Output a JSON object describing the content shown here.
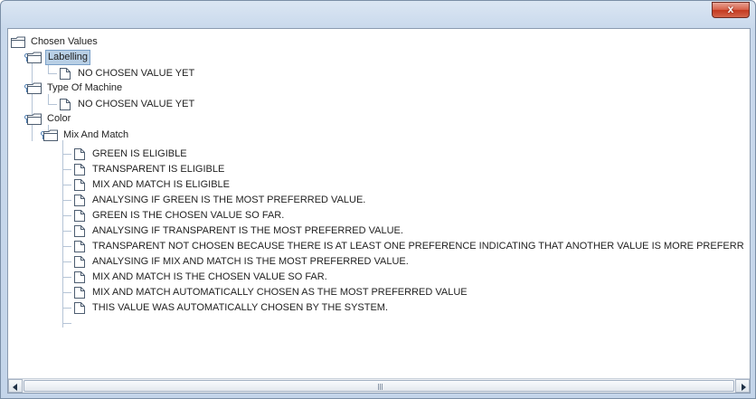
{
  "window": {
    "close_glyph": "x"
  },
  "tree": {
    "nodes": [
      {
        "label": "Chosen Values",
        "type": "folder"
      },
      {
        "label": "Labelling",
        "type": "folder",
        "selected": true
      },
      {
        "label": "NO CHOSEN VALUE YET",
        "type": "file"
      },
      {
        "label": "Type Of Machine",
        "type": "folder"
      },
      {
        "label": "NO CHOSEN VALUE YET",
        "type": "file"
      },
      {
        "label": "Color",
        "type": "folder"
      },
      {
        "label": "Mix And Match",
        "type": "folder"
      },
      {
        "label": "GREEN IS ELIGIBLE",
        "type": "file"
      },
      {
        "label": "TRANSPARENT IS ELIGIBLE",
        "type": "file"
      },
      {
        "label": "MIX AND MATCH IS ELIGIBLE",
        "type": "file"
      },
      {
        "label": "ANALYSING IF GREEN IS THE MOST PREFERRED VALUE.",
        "type": "file"
      },
      {
        "label": "GREEN IS THE CHOSEN VALUE SO FAR.",
        "type": "file"
      },
      {
        "label": "ANALYSING IF TRANSPARENT IS THE MOST PREFERRED VALUE.",
        "type": "file"
      },
      {
        "label": "TRANSPARENT NOT CHOSEN BECAUSE THERE IS AT LEAST ONE PREFERENCE INDICATING THAT ANOTHER VALUE IS MORE PREFERR",
        "type": "file"
      },
      {
        "label": "ANALYSING IF MIX AND MATCH IS THE MOST PREFERRED VALUE.",
        "type": "file"
      },
      {
        "label": "MIX AND MATCH IS THE CHOSEN VALUE SO FAR.",
        "type": "file"
      },
      {
        "label": "MIX AND MATCH AUTOMATICALLY CHOSEN AS THE MOST PREFERRED VALUE",
        "type": "file"
      },
      {
        "label": "THIS VALUE WAS AUTOMATICALLY CHOSEN BY THE SYSTEM.",
        "type": "file"
      }
    ]
  },
  "scrollbar": {
    "grip_glyph": "|||"
  }
}
